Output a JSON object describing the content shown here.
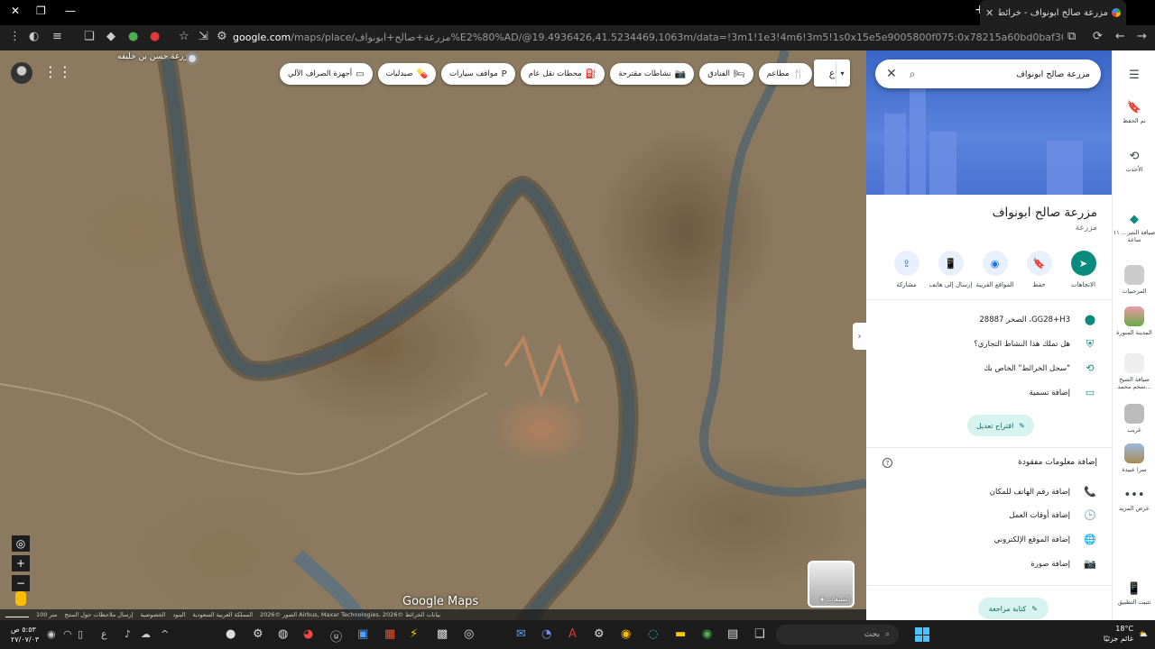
{
  "browser": {
    "tab_title": "مزرعة صالح ابونواف - خرائط Google",
    "url_host": "google.com",
    "url_path": "/maps/place/مزرعة+صالح+ابونواف%E2%80%AD/@19.4936426,41.5234469,1063m/data=!3m1!1e3!4m6!3m5!1s0x15e5e9005800f075:0x78215a60bd0baf30!8m2!3d19.5014434!4d41.5152264!16s%2F..."
  },
  "map": {
    "chips": [
      {
        "icon": "🍴",
        "label": "مطاعم"
      },
      {
        "icon": "🛏",
        "label": "الفنادق"
      },
      {
        "icon": "📷",
        "label": "نشاطات مقترحة"
      },
      {
        "icon": "⛽",
        "label": "محطات نقل عام"
      },
      {
        "icon": "P",
        "label": "مواقف سيارات"
      },
      {
        "icon": "💊",
        "label": "صيدليات"
      },
      {
        "icon": "▭",
        "label": "أجهزة الصراف الآلي"
      }
    ],
    "lang_label": "ع",
    "nearby_label": "مزرعة حسن بن خليفه",
    "brand": "Google Maps",
    "layers_label": "الطبقات",
    "attribution": {
      "scale": "100 متر",
      "imagery": "الصور ©2026 Airbus, Maxar Technologies، بيانات الخرائط ©2026",
      "country": "المملكة العربية السعودية",
      "terms": "البنود",
      "privacy": "الخصوصية",
      "feedback": "إرسال ملاحظات حول المنتج"
    }
  },
  "panel": {
    "search_value": "مزرعة صالح ابونواف",
    "title": "مزرعة صالح ابونواف",
    "category": "مزرعة",
    "actions": [
      {
        "icon": "➤",
        "label": "الاتجاهات",
        "primary": true
      },
      {
        "icon": "🔖",
        "label": "حفظ",
        "primary": false
      },
      {
        "icon": "◉",
        "label": "المواقع القريبة",
        "primary": false
      },
      {
        "icon": "📱",
        "label": "إرسال إلى هاتف",
        "primary": false
      },
      {
        "icon": "⇪",
        "label": "مشاركة",
        "primary": false
      }
    ],
    "address": "GG28+H3، الصخر 28887",
    "claim": "هل تملك هذا النشاط التجاري؟",
    "history": "\"سجل الخرائط\" الخاص بك",
    "label_add": "إضافة تسمية",
    "suggest_edit": "اقتراح تعديل",
    "missing_title": "إضافة معلومات مفقودة",
    "missing_items": [
      {
        "icon": "📞",
        "label": "إضافة رقم الهاتف للمكان"
      },
      {
        "icon": "🕒",
        "label": "إضافة أوقات العمل"
      },
      {
        "icon": "🌐",
        "label": "إضافة الموقع الإلكتروني"
      },
      {
        "icon": "📷",
        "label": "إضافة صورة"
      }
    ],
    "write_review": "كتابة مراجعة"
  },
  "rail": {
    "items": [
      {
        "icon": "🔖",
        "label": "تم الحفظ"
      },
      {
        "icon": "⟲",
        "label": "الأحدث"
      },
      {
        "icon": "◆",
        "label": "صيافة الشر... ١١ ساعة"
      },
      {
        "icon": "",
        "label": "المرجبيات"
      },
      {
        "icon": "",
        "label": "المدينة المنورة"
      },
      {
        "icon": "",
        "label": "صيافة الشيخ سحم محمد..."
      },
      {
        "icon": "",
        "label": "غريب"
      },
      {
        "icon": "",
        "label": "سرا عبيدة"
      },
      {
        "icon": "•••",
        "label": "عرض المزيد"
      },
      {
        "icon": "📱",
        "label": "تثبيت التطبيق"
      }
    ]
  },
  "taskbar": {
    "time": "٥:٥٣ ص",
    "date": "٢٧/٠٧/٠٣",
    "search_placeholder": "بحث",
    "temp": "18°C",
    "weather": "غائم جزئيًا",
    "lang": "ع"
  },
  "colors": {
    "accent": "#0b8a7e",
    "hero_blue": "#3a66c9"
  }
}
